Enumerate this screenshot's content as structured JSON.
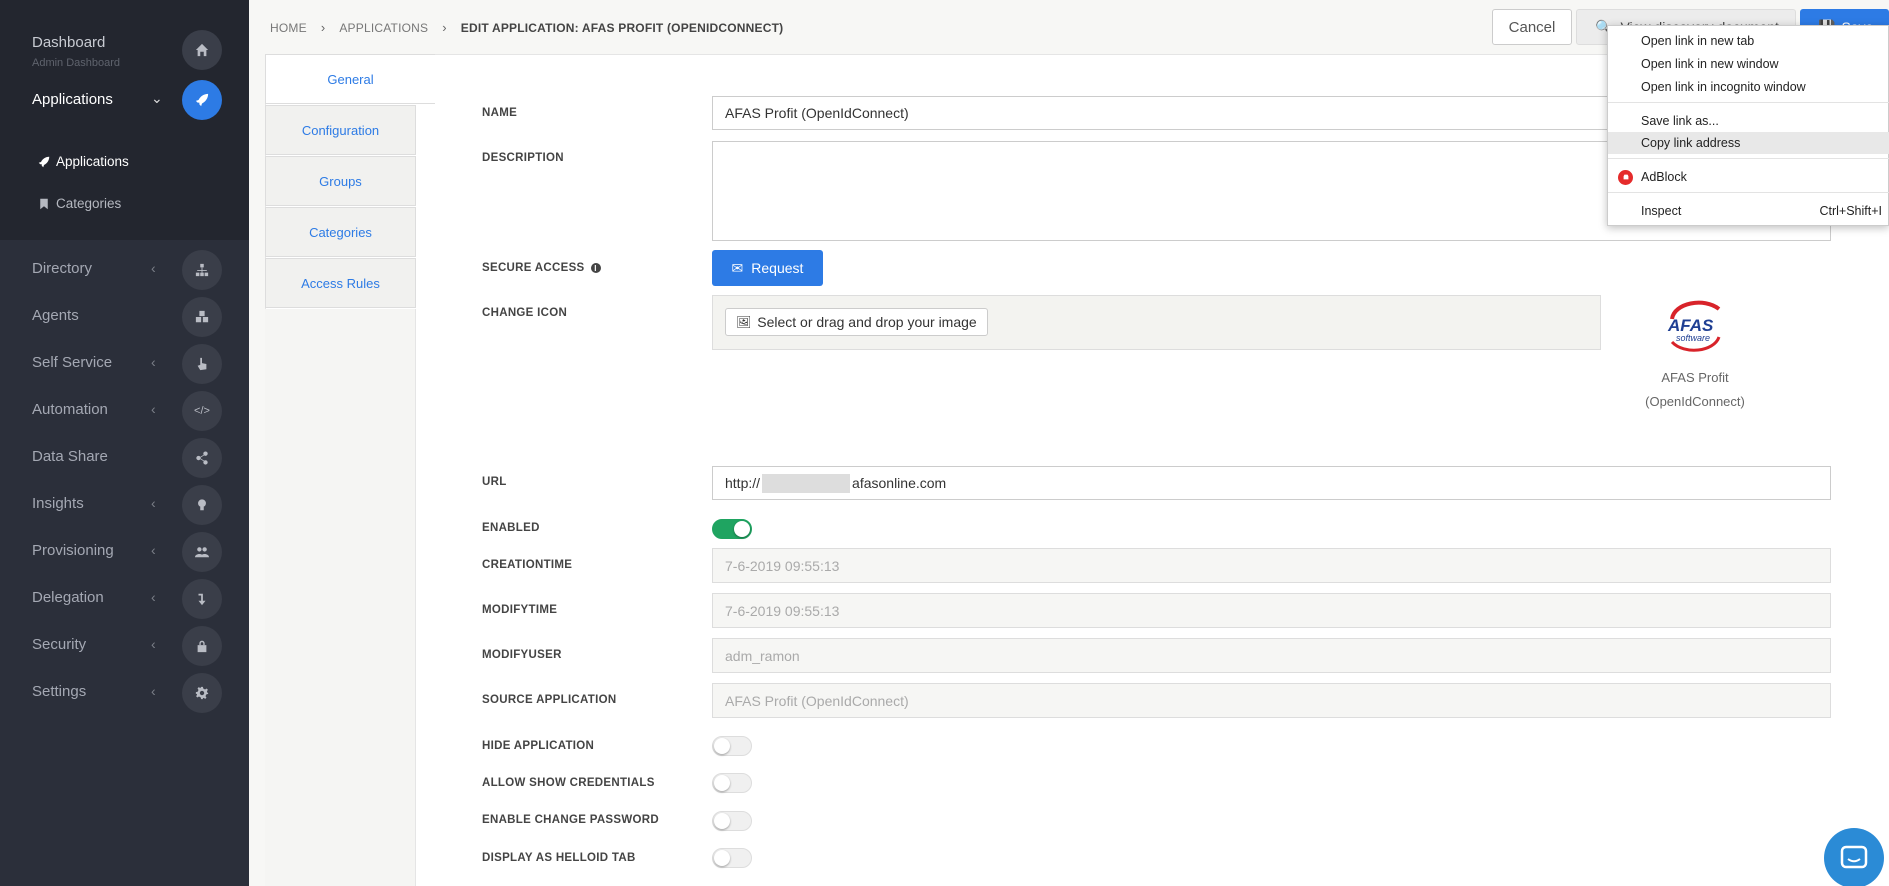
{
  "sidebar": {
    "dashboard_label": "Dashboard",
    "dashboard_sub": "Admin Dashboard",
    "applications_label": "Applications",
    "sub_items": [
      {
        "label": "Applications"
      },
      {
        "label": "Categories"
      }
    ],
    "items": [
      {
        "label": "Directory"
      },
      {
        "label": "Agents"
      },
      {
        "label": "Self Service"
      },
      {
        "label": "Automation"
      },
      {
        "label": "Data Share"
      },
      {
        "label": "Insights"
      },
      {
        "label": "Provisioning"
      },
      {
        "label": "Delegation"
      },
      {
        "label": "Security"
      },
      {
        "label": "Settings"
      }
    ]
  },
  "breadcrumb": {
    "home": "HOME",
    "applications": "APPLICATIONS",
    "current": "EDIT APPLICATION: AFAS PROFIT (OPENIDCONNECT)"
  },
  "header": {
    "cancel_label": "Cancel",
    "discovery_label": "View discovery document",
    "save_label": "Save"
  },
  "tabs": [
    {
      "label": "General"
    },
    {
      "label": "Configuration"
    },
    {
      "label": "Groups"
    },
    {
      "label": "Categories"
    },
    {
      "label": "Access Rules"
    }
  ],
  "form": {
    "name_label": "NAME",
    "name_value": "AFAS Profit (OpenIdConnect)",
    "description_label": "DESCRIPTION",
    "description_value": "",
    "secure_access_label": "SECURE ACCESS",
    "request_label": "Request",
    "change_icon_label": "CHANGE ICON",
    "select_image_label": "Select or drag and drop your image",
    "logo_caption_1": "AFAS Profit",
    "logo_caption_2": "(OpenIdConnect)",
    "logo_text": "AFAS",
    "logo_sub": "software",
    "url_label": "URL",
    "url_prefix": "http://",
    "url_suffix": "afasonline.com",
    "enabled_label": "ENABLED",
    "enabled": true,
    "creationtime_label": "CREATIONTIME",
    "creationtime_value": "7-6-2019 09:55:13",
    "modifytime_label": "MODIFYTIME",
    "modifytime_value": "7-6-2019 09:55:13",
    "modifyuser_label": "MODIFYUSER",
    "modifyuser_value": "adm_ramon",
    "source_label": "SOURCE APPLICATION",
    "source_value": "AFAS Profit (OpenIdConnect)",
    "hide_label": "HIDE APPLICATION",
    "hide": false,
    "allow_creds_label": "ALLOW SHOW CREDENTIALS",
    "allow_creds": false,
    "change_pw_label": "ENABLE CHANGE PASSWORD",
    "change_pw": false,
    "helloid_tab_label": "DISPLAY AS HELLOID TAB",
    "helloid_tab": false
  },
  "context_menu": {
    "open_new_tab": "Open link in new tab",
    "open_new_window": "Open link in new window",
    "open_incognito": "Open link in incognito window",
    "save_link": "Save link as...",
    "copy_link": "Copy link address",
    "adblock": "AdBlock",
    "inspect": "Inspect",
    "inspect_shortcut": "Ctrl+Shift+I"
  },
  "colors": {
    "accent": "#2d7be5",
    "sidebar_bg": "#2b2f3a",
    "toggle_on": "#1fa461",
    "afas_red": "#d8232a",
    "afas_blue": "#1f3f93"
  }
}
